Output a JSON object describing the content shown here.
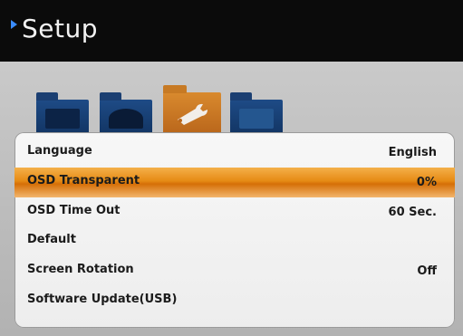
{
  "header": {
    "title": "Setup"
  },
  "menu_icons": [
    {
      "name": "picture-folder-icon"
    },
    {
      "name": "sound-folder-icon"
    },
    {
      "name": "setup-wrench-folder-icon",
      "selected": true
    },
    {
      "name": "channel-folder-icon"
    }
  ],
  "menu": [
    {
      "label": "Language",
      "value": "English"
    },
    {
      "label": "OSD Transparent",
      "value": "0%",
      "highlighted": true
    },
    {
      "label": "OSD Time Out",
      "value": "60 Sec."
    },
    {
      "label": "Default",
      "value": ""
    },
    {
      "label": "Screen Rotation",
      "value": "Off"
    },
    {
      "label": "Software Update(USB)",
      "value": ""
    }
  ],
  "colors": {
    "header_bg": "#0b0b0b",
    "accent_arrow": "#3a8cff",
    "highlight_orange": "#e68a14",
    "panel_bg": "#f3f3f3"
  }
}
